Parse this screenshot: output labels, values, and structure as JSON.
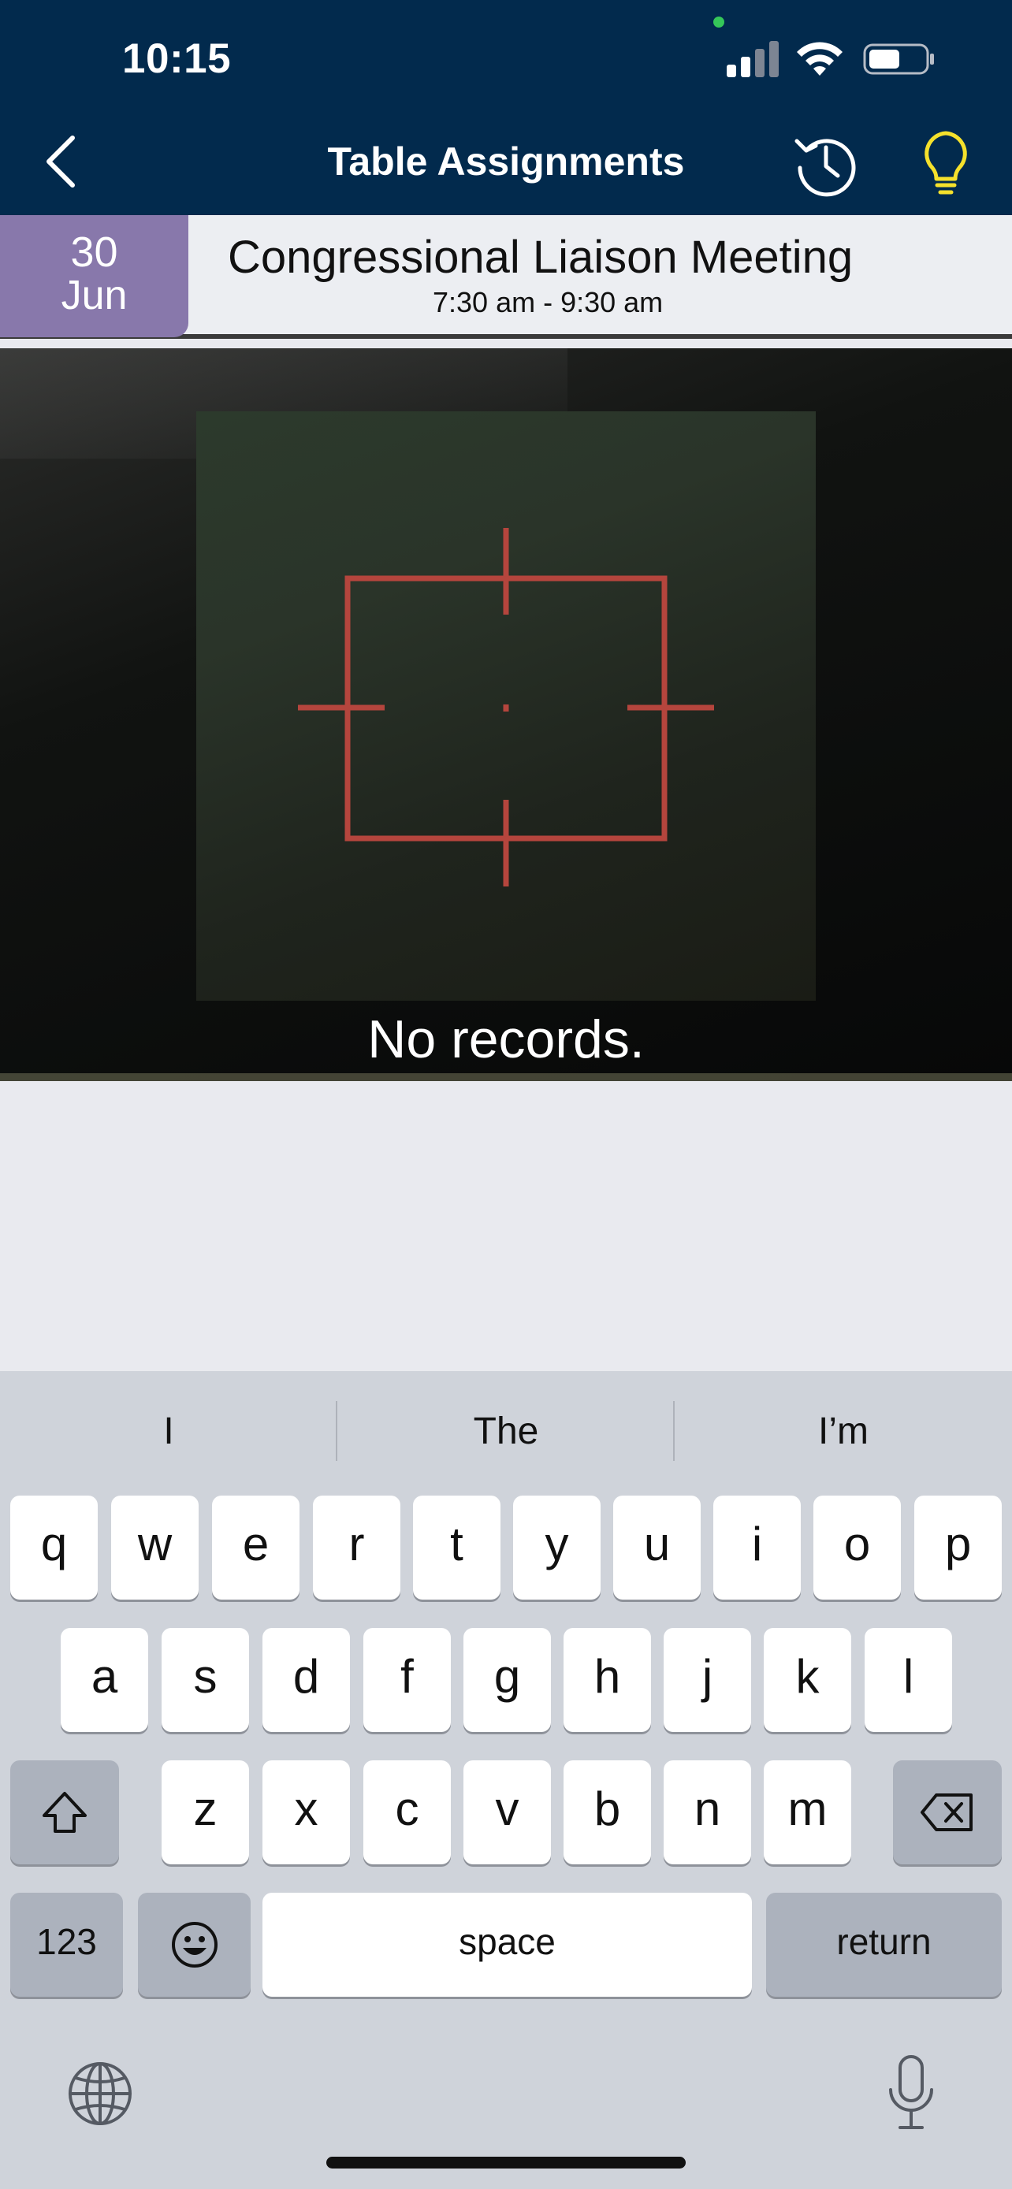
{
  "status_bar": {
    "time": "10:15"
  },
  "nav": {
    "title": "Table Assignments"
  },
  "event": {
    "day": "30",
    "month": "Jun",
    "title": "Congressional Liaison Meeting",
    "time": "7:30 am - 9:30 am"
  },
  "scanner": {
    "empty_message": "No records."
  },
  "keyboard": {
    "suggestions": [
      "I",
      "The",
      "I’m"
    ],
    "row1": [
      "q",
      "w",
      "e",
      "r",
      "t",
      "y",
      "u",
      "i",
      "o",
      "p"
    ],
    "row2": [
      "a",
      "s",
      "d",
      "f",
      "g",
      "h",
      "j",
      "k",
      "l"
    ],
    "row3": [
      "z",
      "x",
      "c",
      "v",
      "b",
      "n",
      "m"
    ],
    "numbers_key": "123",
    "space_key": "space",
    "return_key": "return"
  },
  "colors": {
    "header_bg": "#022a4d",
    "date_badge": "#8878ab",
    "reticle": "#b5453d",
    "bulb": "#f5e12c"
  },
  "icons": {
    "back": "chevron-left-icon",
    "history": "history-icon",
    "tips": "lightbulb-icon",
    "shift": "shift-icon",
    "delete": "backspace-icon",
    "emoji": "emoji-icon",
    "globe": "globe-icon",
    "mic": "microphone-icon"
  }
}
